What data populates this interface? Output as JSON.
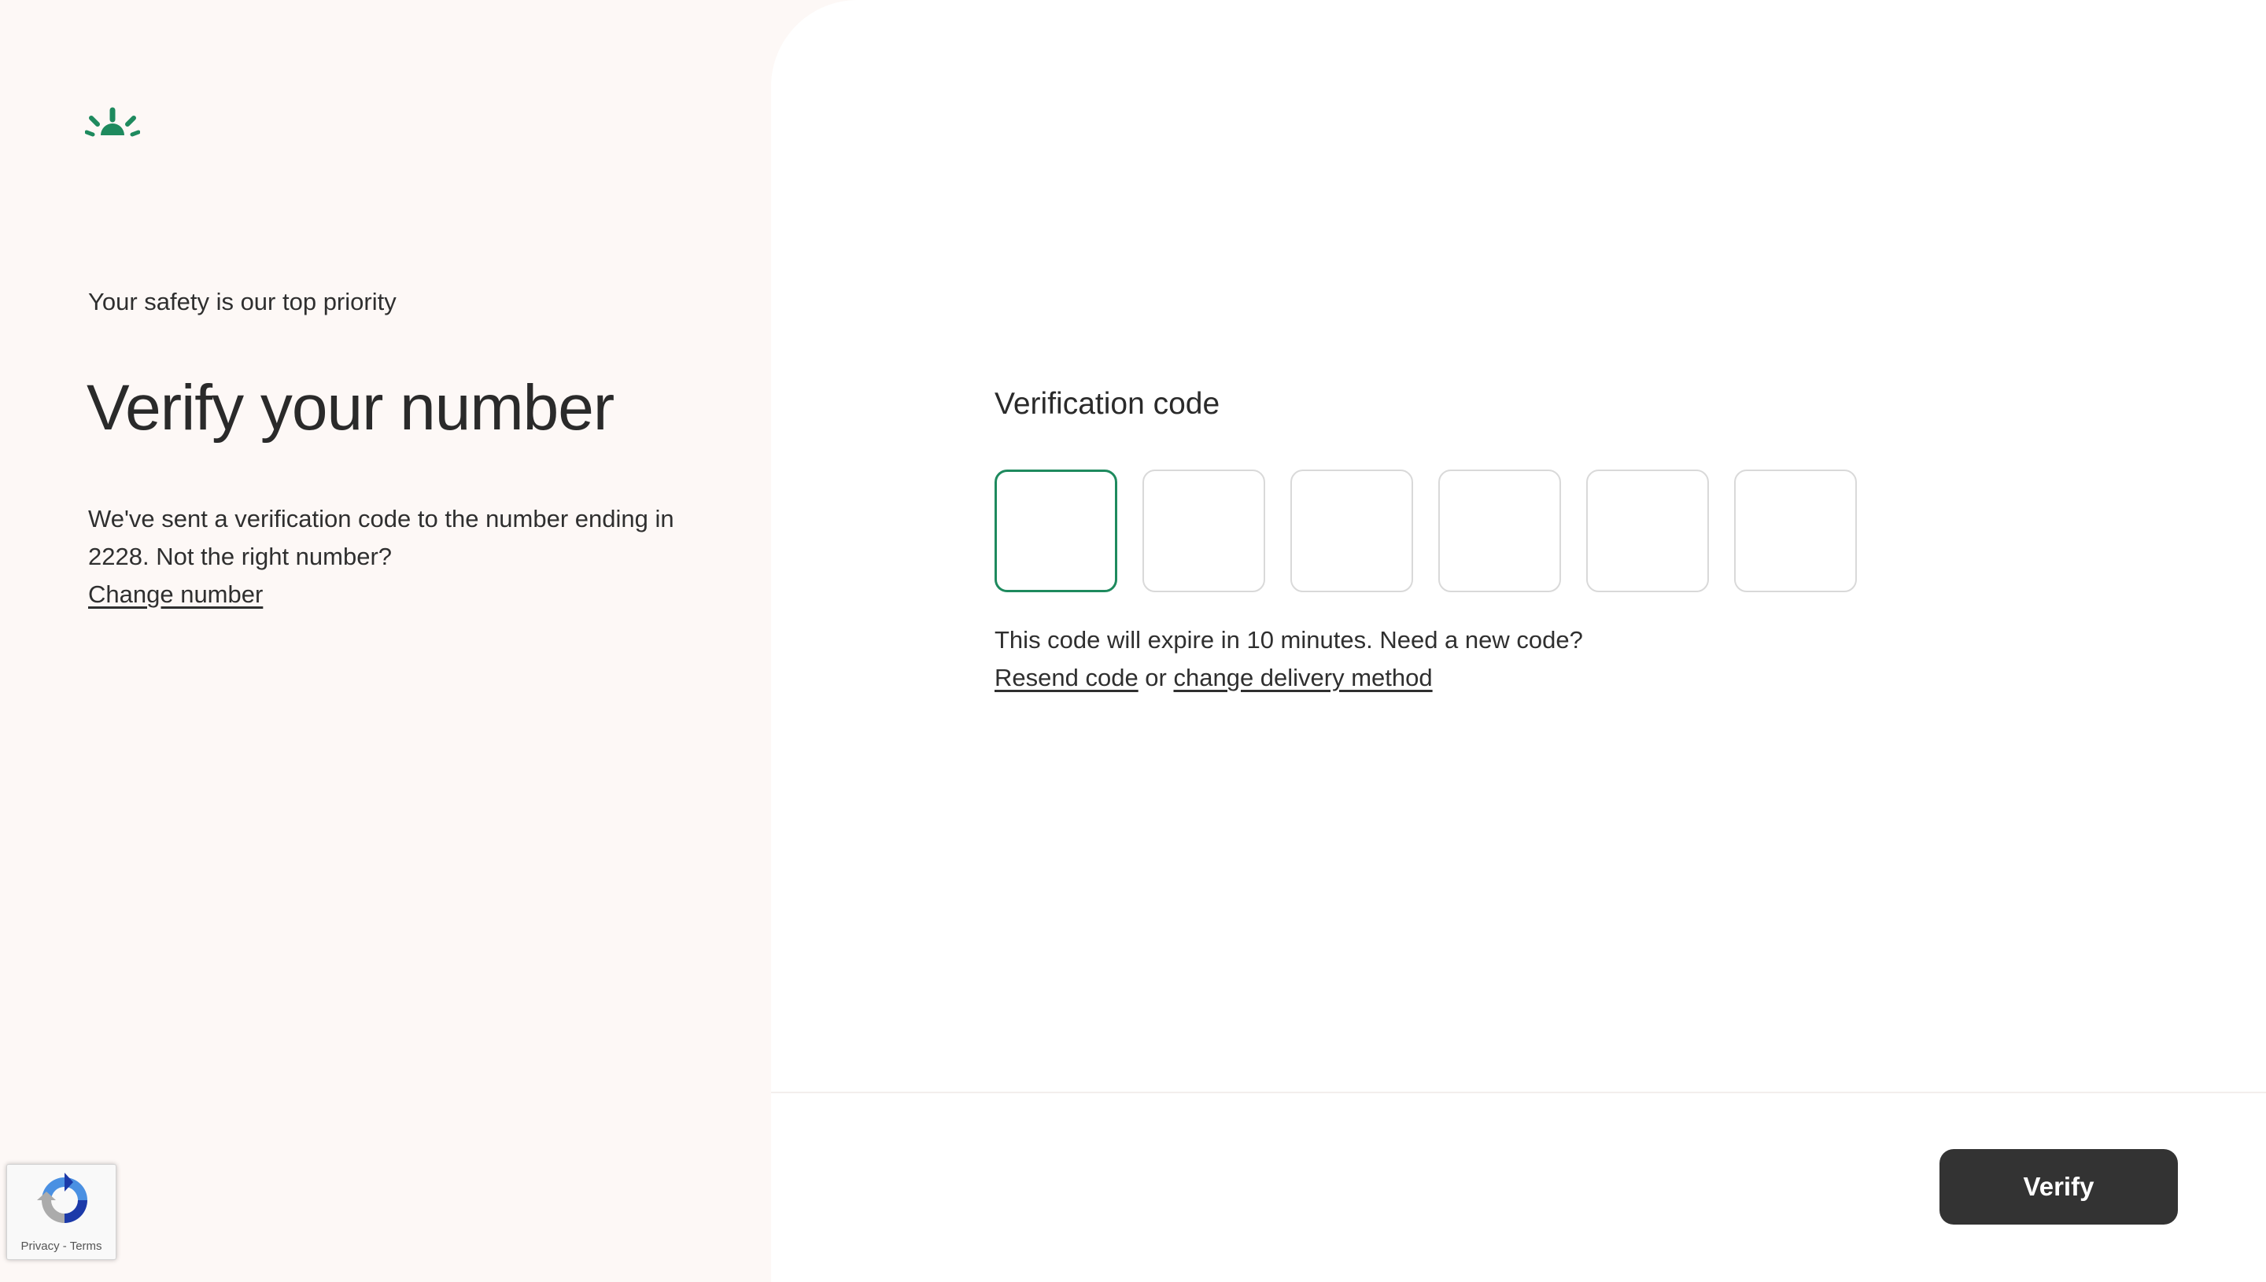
{
  "brand": {
    "logo_icon": "sun-rays-icon",
    "accent_color": "#1e8a5e"
  },
  "intro": {
    "eyebrow": "Your safety is our top priority",
    "title": "Verify your number",
    "description": "We've sent a verification code to the number ending in 2228. Not the right number?",
    "change_number_link": "Change number"
  },
  "form": {
    "label": "Verification code",
    "code_digits": [
      "",
      "",
      "",
      "",
      "",
      ""
    ],
    "helper_text": "This code will expire in 10 minutes. Need a new code?",
    "resend_link": "Resend code",
    "or_text": " or ",
    "change_method_link": "change delivery method"
  },
  "footer": {
    "verify_label": "Verify"
  },
  "recaptcha": {
    "icon": "recaptcha-icon",
    "privacy": "Privacy",
    "separator": " - ",
    "terms": "Terms"
  }
}
